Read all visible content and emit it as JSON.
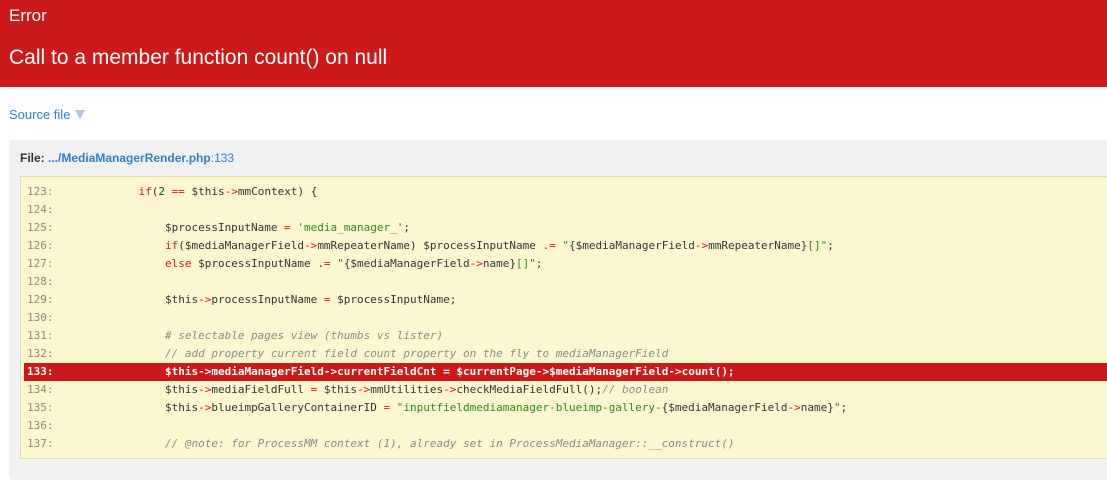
{
  "error": {
    "type": "Error",
    "message": "Call to a member function count() on null"
  },
  "source_toggle": {
    "label": "Source file",
    "icon": "caret-down-icon"
  },
  "file": {
    "label": "File:",
    "path": ".../MediaManagerRender.php",
    "separator": ":",
    "line": "133"
  },
  "colors": {
    "error_red": "#cc1a1a",
    "link_blue": "#2f7fc9",
    "code_bg": "#fdf7cf",
    "panel_bg": "#f1f1f1",
    "string_green": "#2a8a1c"
  },
  "highlight_line": "133",
  "code_lines": [
    {
      "num": "123:",
      "text": "            if(2 == $this->mmContext) {"
    },
    {
      "num": "124:",
      "text": ""
    },
    {
      "num": "125:",
      "text": "                $processInputName = 'media_manager_';"
    },
    {
      "num": "126:",
      "text": "                if($mediaManagerField->mmRepeaterName) $processInputName .= \"{$mediaManagerField->mmRepeaterName}[]\";"
    },
    {
      "num": "127:",
      "text": "                else $processInputName .= \"{$mediaManagerField->name}[]\";"
    },
    {
      "num": "128:",
      "text": ""
    },
    {
      "num": "129:",
      "text": "                $this->processInputName = $processInputName;"
    },
    {
      "num": "130:",
      "text": ""
    },
    {
      "num": "131:",
      "text": "                # selectable pages view (thumbs vs lister)"
    },
    {
      "num": "132:",
      "text": "                // add property current field count property on the fly to mediaManagerField"
    },
    {
      "num": "133:",
      "text": "                $this->mediaManagerField->currentFieldCnt = $currentPage->$mediaManagerField->count();"
    },
    {
      "num": "134:",
      "text": "                $this->mediaFieldFull = $this->mmUtilities->checkMediaFieldFull();// boolean"
    },
    {
      "num": "135:",
      "text": "                $this->blueimpGalleryContainerID = \"inputfieldmediamanager-blueimp-gallery-{$mediaManagerField->name}\";"
    },
    {
      "num": "136:",
      "text": ""
    },
    {
      "num": "137:",
      "text": "                // @note: for ProcessMM context (1), already set in ProcessMediaManager::__construct()"
    }
  ]
}
